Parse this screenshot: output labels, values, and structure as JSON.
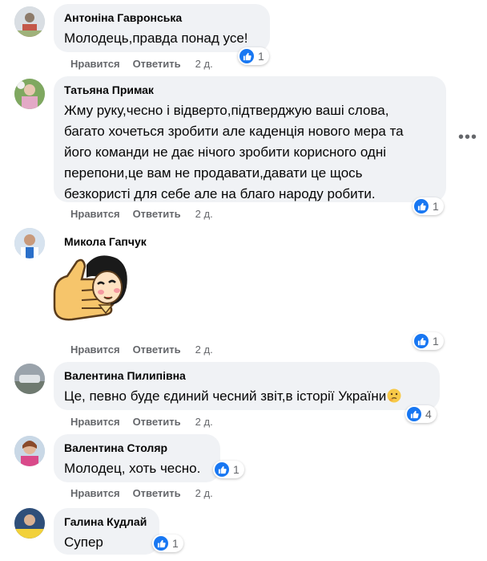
{
  "action_labels": {
    "like": "Нравится",
    "reply": "Ответить"
  },
  "reaction_icon": "like-icon",
  "more_icon": "more-options-icon",
  "accent_color": "#1877f2",
  "comments": [
    {
      "author": "Антоніна Гавронська",
      "text": "Молодець,правда понад усе!",
      "time": "2 д.",
      "reactions": "1"
    },
    {
      "author": "Татьяна Примак",
      "text": "Жму руку,чесно і відверто,підтверджую ваші слова,\nбагато хочеться зробити але каденція нового мера та\nйого команди не дає нічого зробити корисного одні\nперепони,це вам не продавати,давати це щось\nбезкористі для себе але на благо народу робити.",
      "time": "2 д.",
      "reactions": "1"
    },
    {
      "author": "Микола Гапчук",
      "text": "",
      "sticker": "thumbs-up-sticker",
      "time": "2 д.",
      "reactions": "1"
    },
    {
      "author": "Валентина Пилипівна",
      "text": "Це, певно буде єдиний чесний звіт,в історії України",
      "emoji": "thinking-face-emoji",
      "time": "2 д.",
      "reactions": "4"
    },
    {
      "author": "Валентина Столяр",
      "text": "Молодец, хоть чесно.",
      "time": "2 д.",
      "reactions": "1"
    },
    {
      "author": "Галина Кудлай",
      "text": "Супер",
      "reactions": "1"
    }
  ]
}
